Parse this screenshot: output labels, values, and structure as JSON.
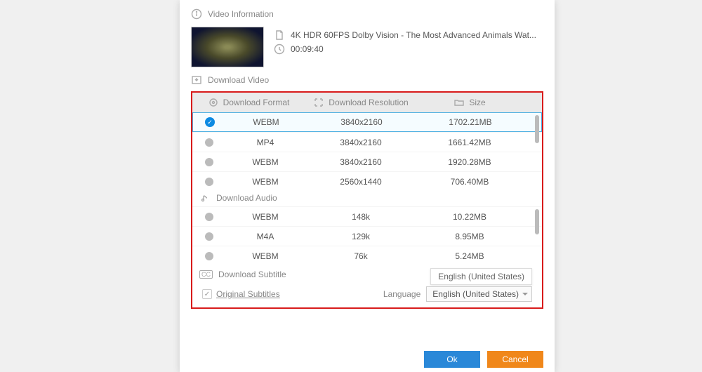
{
  "sections": {
    "info": "Video Information",
    "video": "Download Video",
    "audio": "Download Audio",
    "subtitle": "Download Subtitle"
  },
  "video_title": "4K HDR 60FPS Dolby Vision - The Most Advanced Animals Wat...",
  "duration": "00:09:40",
  "columns": {
    "format": "Download Format",
    "resolution": "Download Resolution",
    "size": "Size"
  },
  "video_rows": [
    {
      "fmt": "WEBM",
      "res": "3840x2160",
      "size": "1702.21MB",
      "selected": true
    },
    {
      "fmt": "MP4",
      "res": "3840x2160",
      "size": "1661.42MB"
    },
    {
      "fmt": "WEBM",
      "res": "3840x2160",
      "size": "1920.28MB"
    },
    {
      "fmt": "WEBM",
      "res": "2560x1440",
      "size": "706.40MB"
    }
  ],
  "audio_rows": [
    {
      "fmt": "WEBM",
      "res": "148k",
      "size": "10.22MB"
    },
    {
      "fmt": "M4A",
      "res": "129k",
      "size": "8.95MB"
    },
    {
      "fmt": "WEBM",
      "res": "76k",
      "size": "5.24MB"
    }
  ],
  "subtitle": {
    "original": "Original Subtitles",
    "language_label": "Language",
    "language_value": "English (United States)",
    "popup": "English (United States)"
  },
  "buttons": {
    "ok": "Ok",
    "cancel": "Cancel"
  }
}
